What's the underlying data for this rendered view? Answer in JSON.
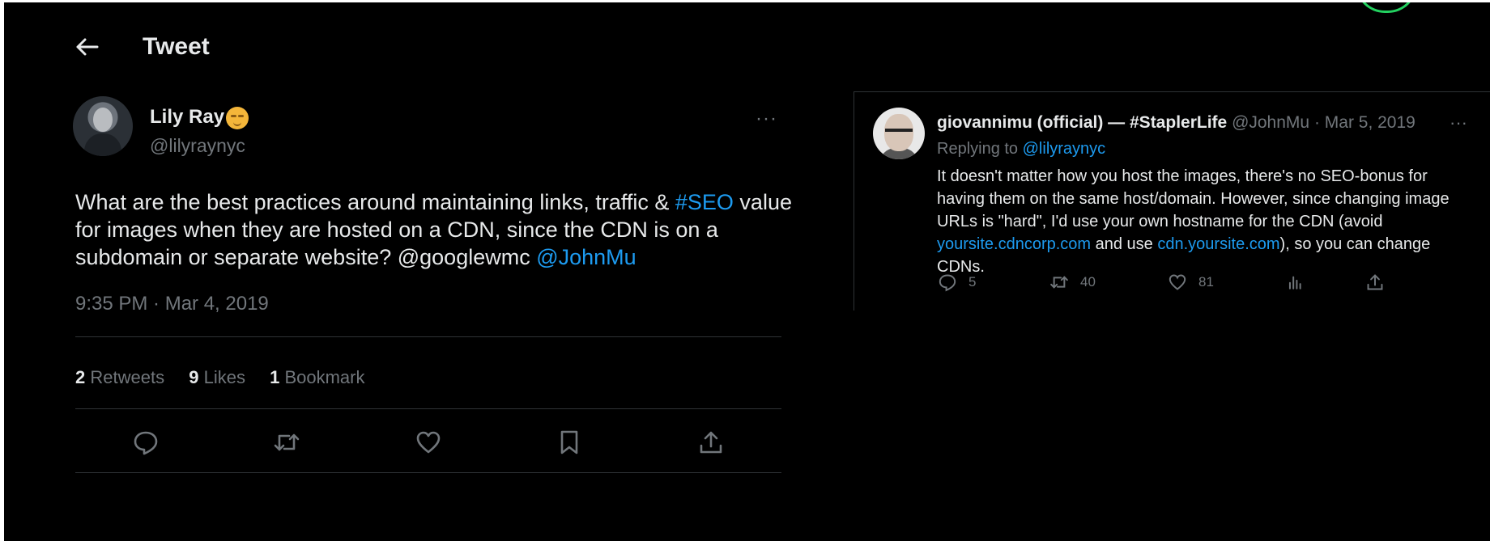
{
  "header": {
    "title": "Tweet"
  },
  "main_tweet": {
    "name": "Lily Ray",
    "handle": "@lilyraynyc",
    "text_parts": [
      "What are the best practices around maintaining links, traffic & ",
      "#SEO",
      " value for images when they are hosted on a CDN, since the CDN is on a subdomain or separate website? @googlewmc ",
      "@JohnMu"
    ],
    "timestamp": "9:35 PM · Mar 4, 2019",
    "stats": {
      "retweets_count": "2",
      "retweets_label": "Retweets",
      "likes_count": "9",
      "likes_label": "Likes",
      "bookmarks_count": "1",
      "bookmarks_label": "Bookmark"
    },
    "more_label": "···"
  },
  "reply_tweet": {
    "name": "giovannimu (official) — #StaplerLife",
    "handle": "@JohnMu",
    "date": "· Mar 5, 2019",
    "replying_to_label": "Replying to ",
    "replying_to_handle": "@lilyraynyc",
    "text_parts": [
      "It doesn't matter how you host the images, there's no SEO-bonus for having them on the same host/domain. However, since changing image URLs is \"hard\", I'd use your own hostname for the CDN (avoid ",
      "yoursite.cdncorp.com",
      " and use ",
      "cdn.yoursite.com",
      "), so you can change CDNs."
    ],
    "replies": "5",
    "retweets": "40",
    "likes": "81",
    "more_label": "···"
  },
  "icons": {
    "back": "arrow-left-icon",
    "reply": "comment-icon",
    "retweet": "retweet-icon",
    "like": "heart-icon",
    "bookmark": "bookmark-icon",
    "share": "share-icon",
    "analytics": "bar-chart-icon"
  },
  "colors": {
    "background": "#000000",
    "link": "#1d9bf0",
    "muted": "#71767b",
    "text": "#e7e9ea",
    "divider": "#2f3336"
  }
}
